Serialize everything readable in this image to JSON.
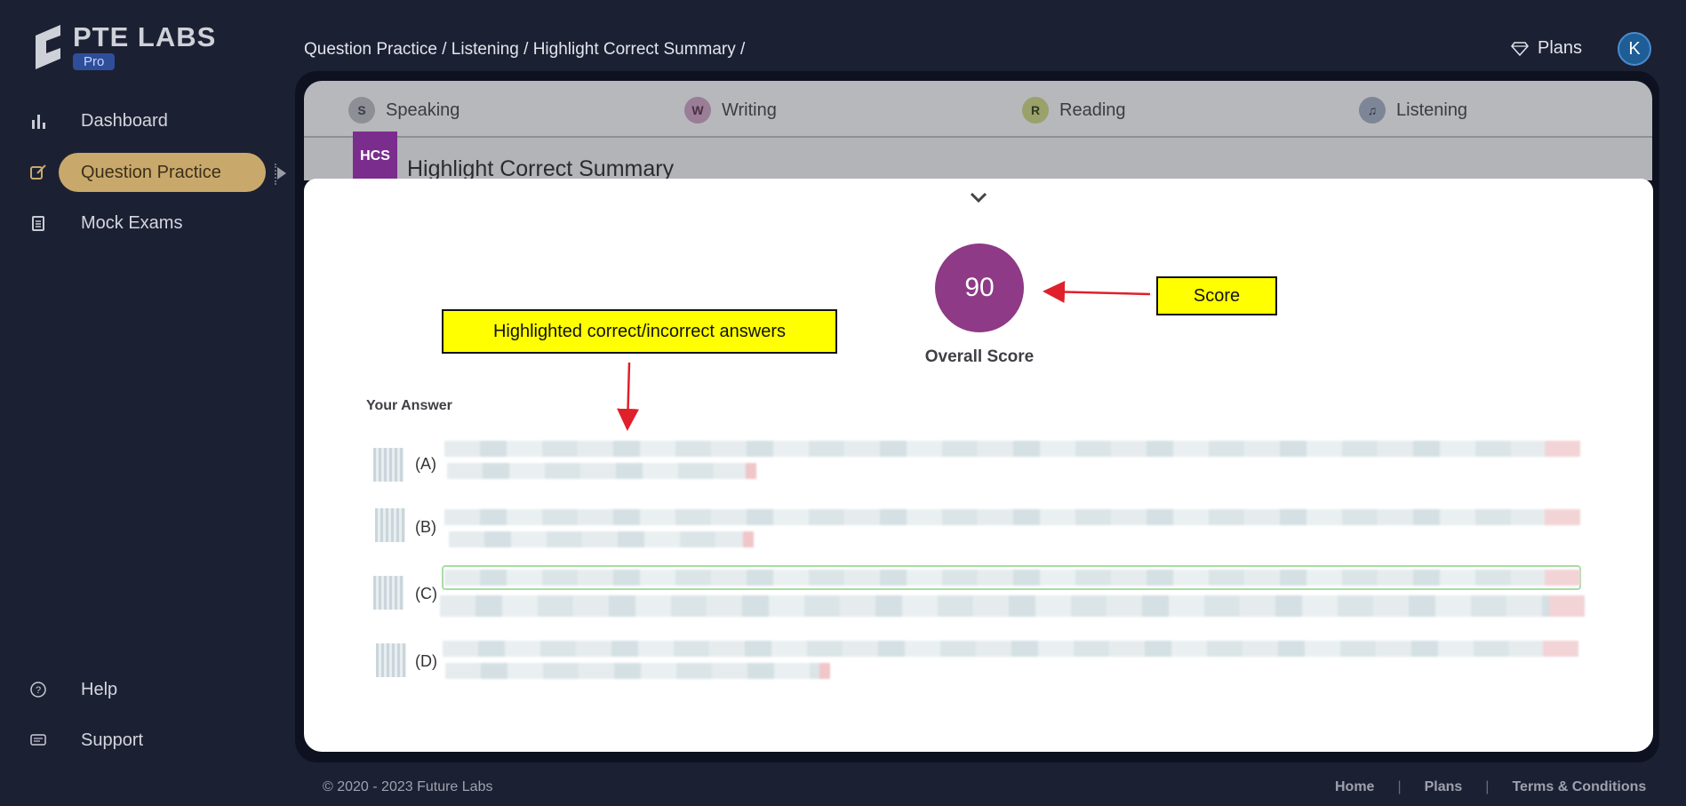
{
  "brand": {
    "name": "PTE LABS",
    "badge": "Pro"
  },
  "sidebar": {
    "items": [
      {
        "label": "Dashboard",
        "icon": "bar-chart-icon"
      },
      {
        "label": "Question Practice",
        "icon": "edit-icon",
        "active": true
      },
      {
        "label": "Mock Exams",
        "icon": "clipboard-icon"
      }
    ],
    "bottom_items": [
      {
        "label": "Help",
        "icon": "help-circle-icon"
      },
      {
        "label": "Support",
        "icon": "support-icon"
      }
    ]
  },
  "header": {
    "breadcrumb": "Question Practice / Listening / Highlight Correct Summary /",
    "plans_label": "Plans",
    "plans_icon": "diamond-icon",
    "avatar_initial": "K"
  },
  "tabs": [
    {
      "label": "Speaking",
      "icon": "speaking-icon"
    },
    {
      "label": "Writing",
      "icon": "writing-icon"
    },
    {
      "label": "Reading",
      "icon": "reading-icon"
    },
    {
      "label": "Listening",
      "icon": "headphones-icon"
    }
  ],
  "task": {
    "badge": "HCS",
    "title": "Highlight Correct Summary"
  },
  "result": {
    "score": "90",
    "score_label": "Overall Score",
    "your_answer_label": "Your Answer",
    "options": [
      {
        "letter": "(A)"
      },
      {
        "letter": "(B)"
      },
      {
        "letter": "(C)",
        "correct": true
      },
      {
        "letter": "(D)"
      }
    ]
  },
  "annotations": {
    "score_note": "Score",
    "highlight_note": "Highlighted correct/incorrect answers",
    "color": "#ffff00",
    "arrow_color": "#e0202a"
  },
  "footer": {
    "copyright": "© 2020 - 2023 Future Labs",
    "links": [
      "Home",
      "Plans",
      "Terms & Conditions"
    ],
    "separator": "|"
  }
}
